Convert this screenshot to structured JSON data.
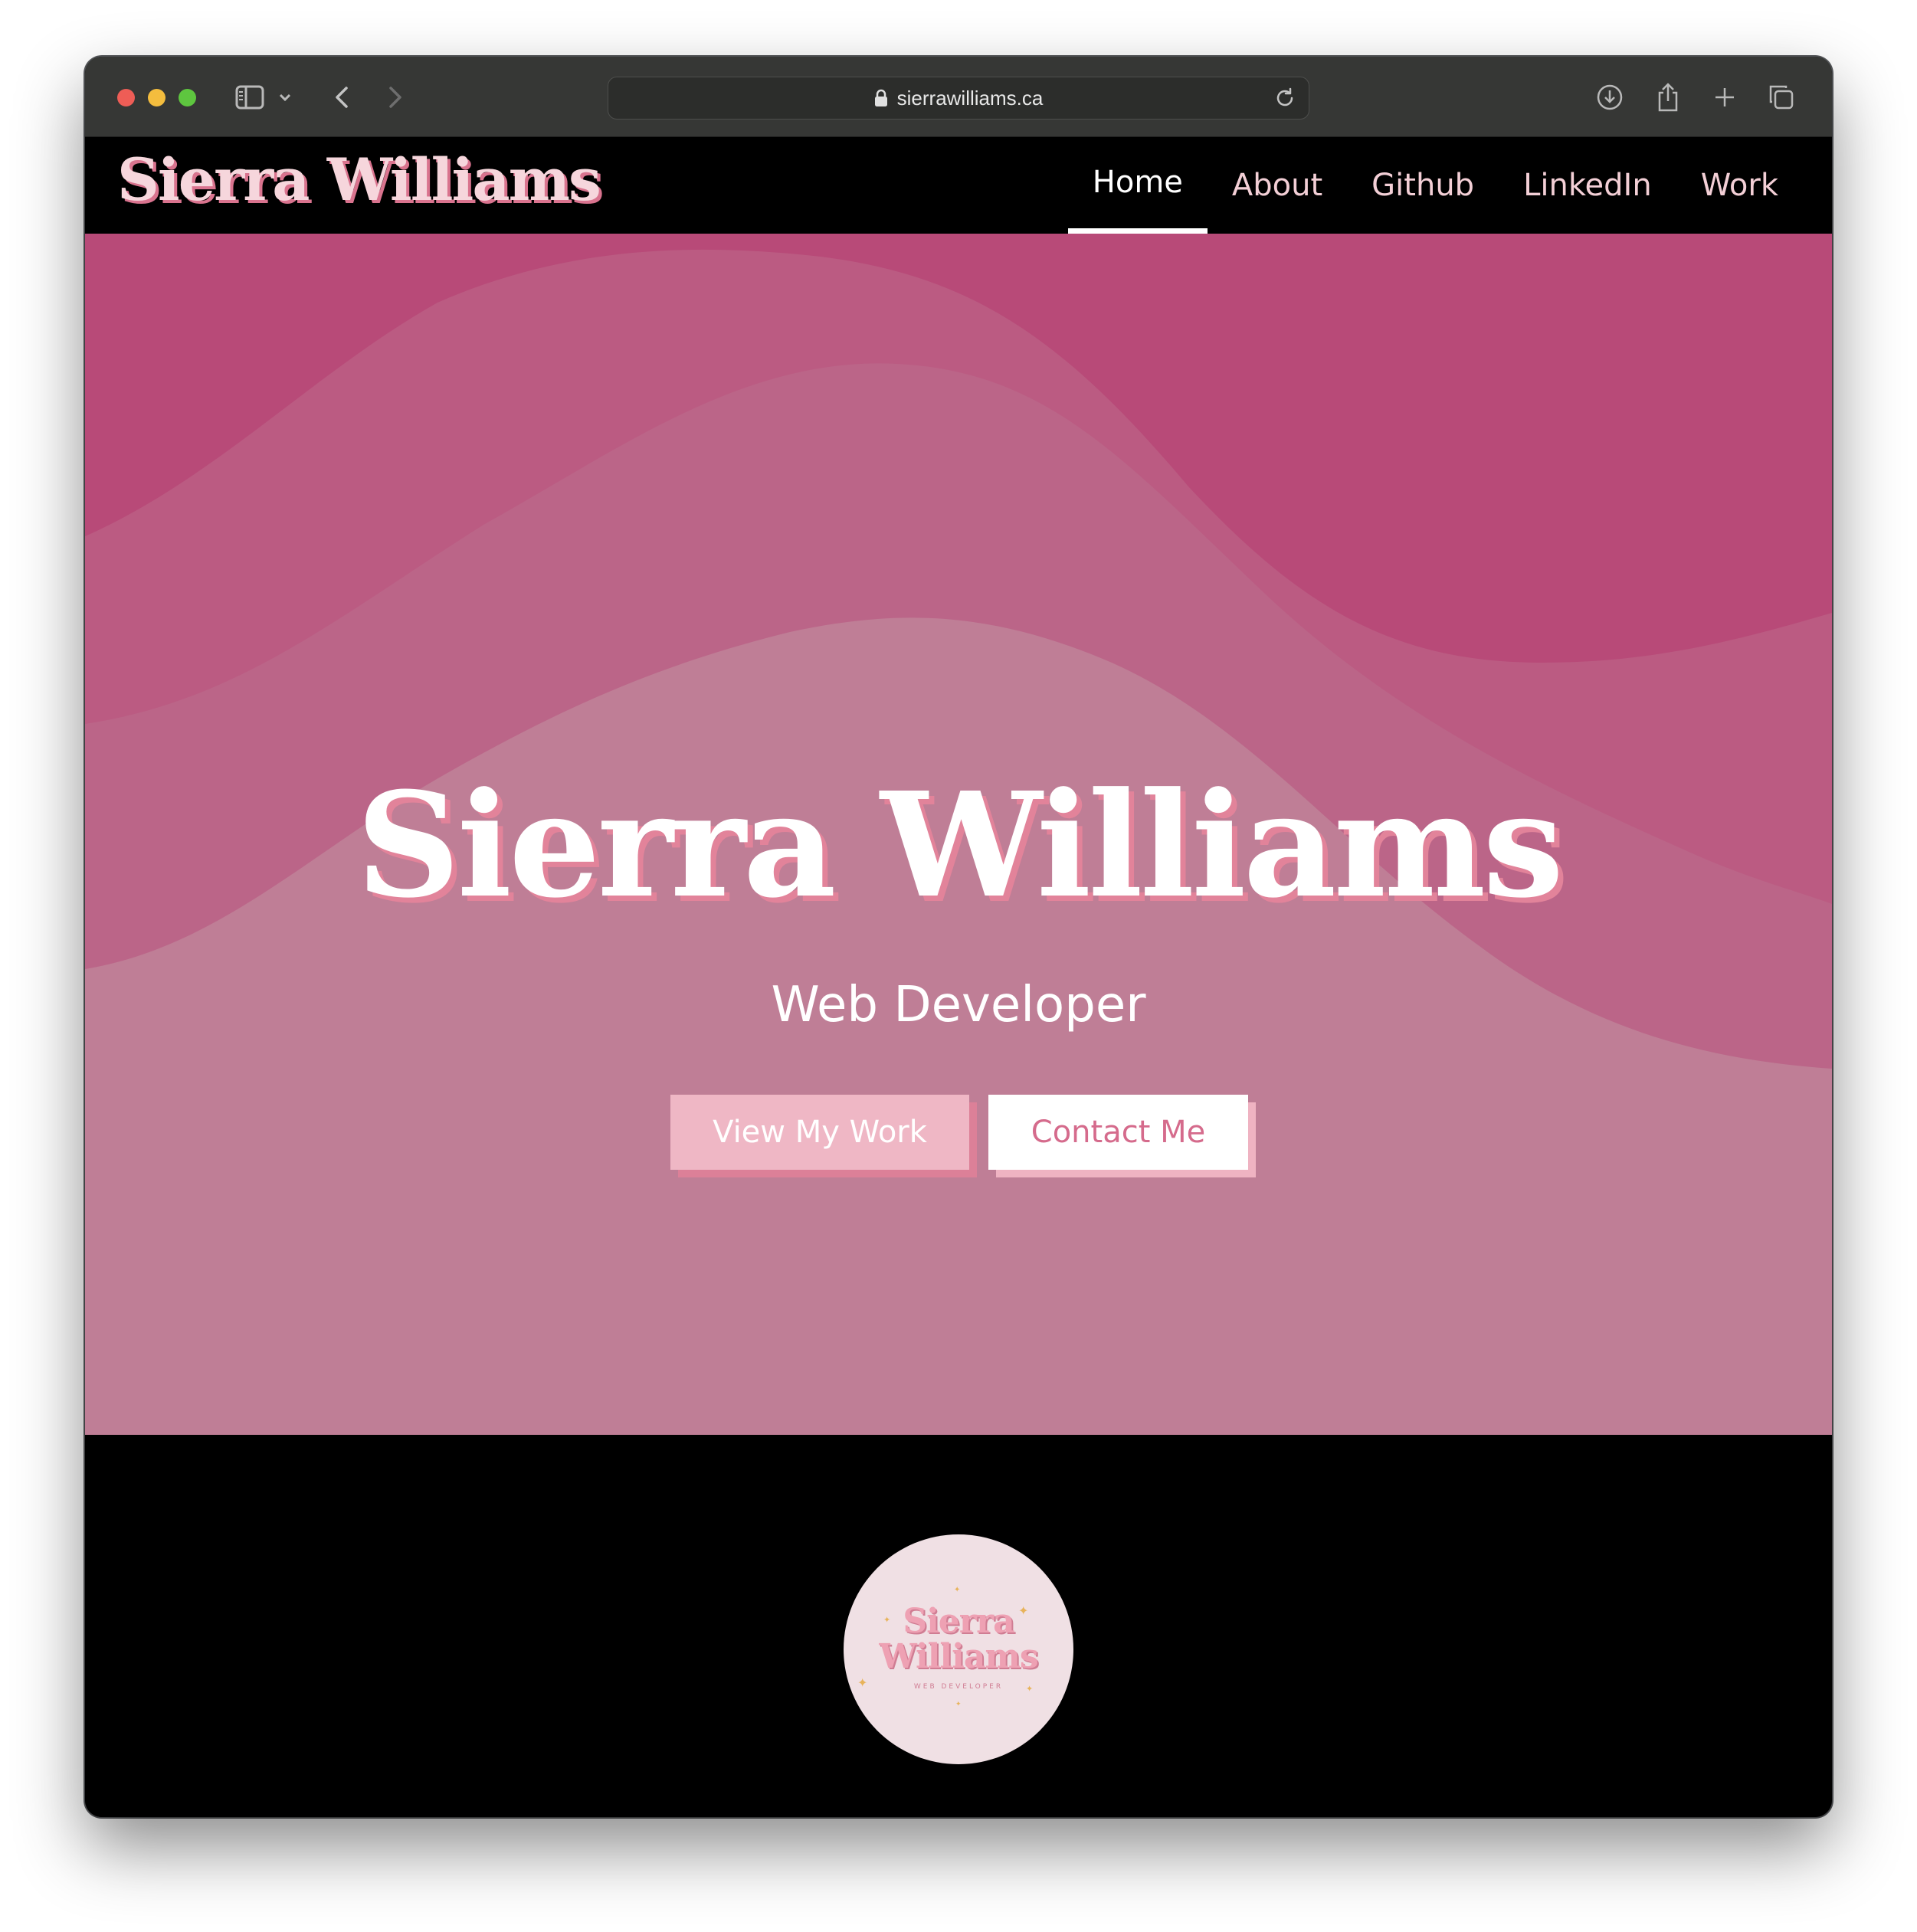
{
  "browser": {
    "url": "sierrawilliams.ca",
    "icons": [
      "sidebar-icon",
      "chevron-down-icon",
      "back-icon",
      "forward-icon",
      "lock-icon",
      "reload-icon",
      "download-icon",
      "share-icon",
      "new-tab-icon",
      "tabs-overview-icon"
    ]
  },
  "site": {
    "brand": "Sierra Williams",
    "nav": [
      {
        "label": "Home",
        "active": true
      },
      {
        "label": "About",
        "active": false
      },
      {
        "label": "Github",
        "active": false
      },
      {
        "label": "LinkedIn",
        "active": false
      },
      {
        "label": "Work",
        "active": false
      }
    ]
  },
  "hero": {
    "title": "Sierra Williams",
    "subtitle": "Web Developer",
    "primary_button": "View My Work",
    "secondary_button": "Contact Me"
  },
  "logo": {
    "line1": "Sierra",
    "line2": "Williams",
    "tagline": "WEB DEVELOPER"
  },
  "colors": {
    "hero_base": "#bf7e96",
    "wave_dark": "#b84a78",
    "accent_pink": "#efb7c5",
    "nav_bg": "#000000"
  }
}
